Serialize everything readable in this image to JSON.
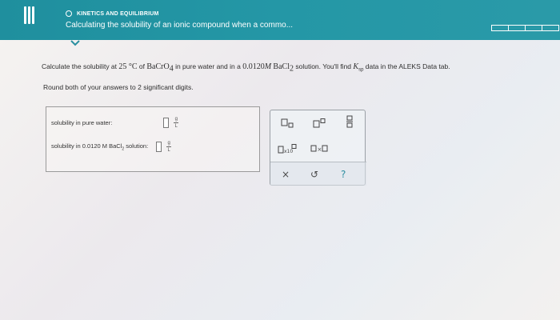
{
  "header": {
    "topic": "KINETICS AND EQUILIBRIUM",
    "title": "Calculating the solubility of an ionic compound when a commo..."
  },
  "question": {
    "part1": "Calculate the solubility at ",
    "temp": "25 °C",
    "part2": " of ",
    "compound_base": "BaCrO",
    "compound_sub": "4",
    "part3": " in pure water and in a ",
    "conc": "0.0120",
    "conc_unit": "M",
    "salt_base": "BaCl",
    "salt_sub": "2",
    "part4": " solution. You'll find ",
    "k": "K",
    "k_sub": "sp",
    "part5": " data in the ALEKS Data tab."
  },
  "instruction": "Round both of your answers to 2 significant digits.",
  "answers": {
    "row1_label": "solubility in pure water:",
    "row2_label_a": "solubility in 0.0120 M BaCl",
    "row2_label_sub": "2",
    "row2_label_b": " solution:",
    "unit_num": "g",
    "unit_den": "L"
  },
  "toolbar": {
    "close": "×",
    "undo": "↺",
    "help": "?"
  },
  "colors": {
    "header": "#2497a6",
    "accent": "#2e8fa0"
  }
}
